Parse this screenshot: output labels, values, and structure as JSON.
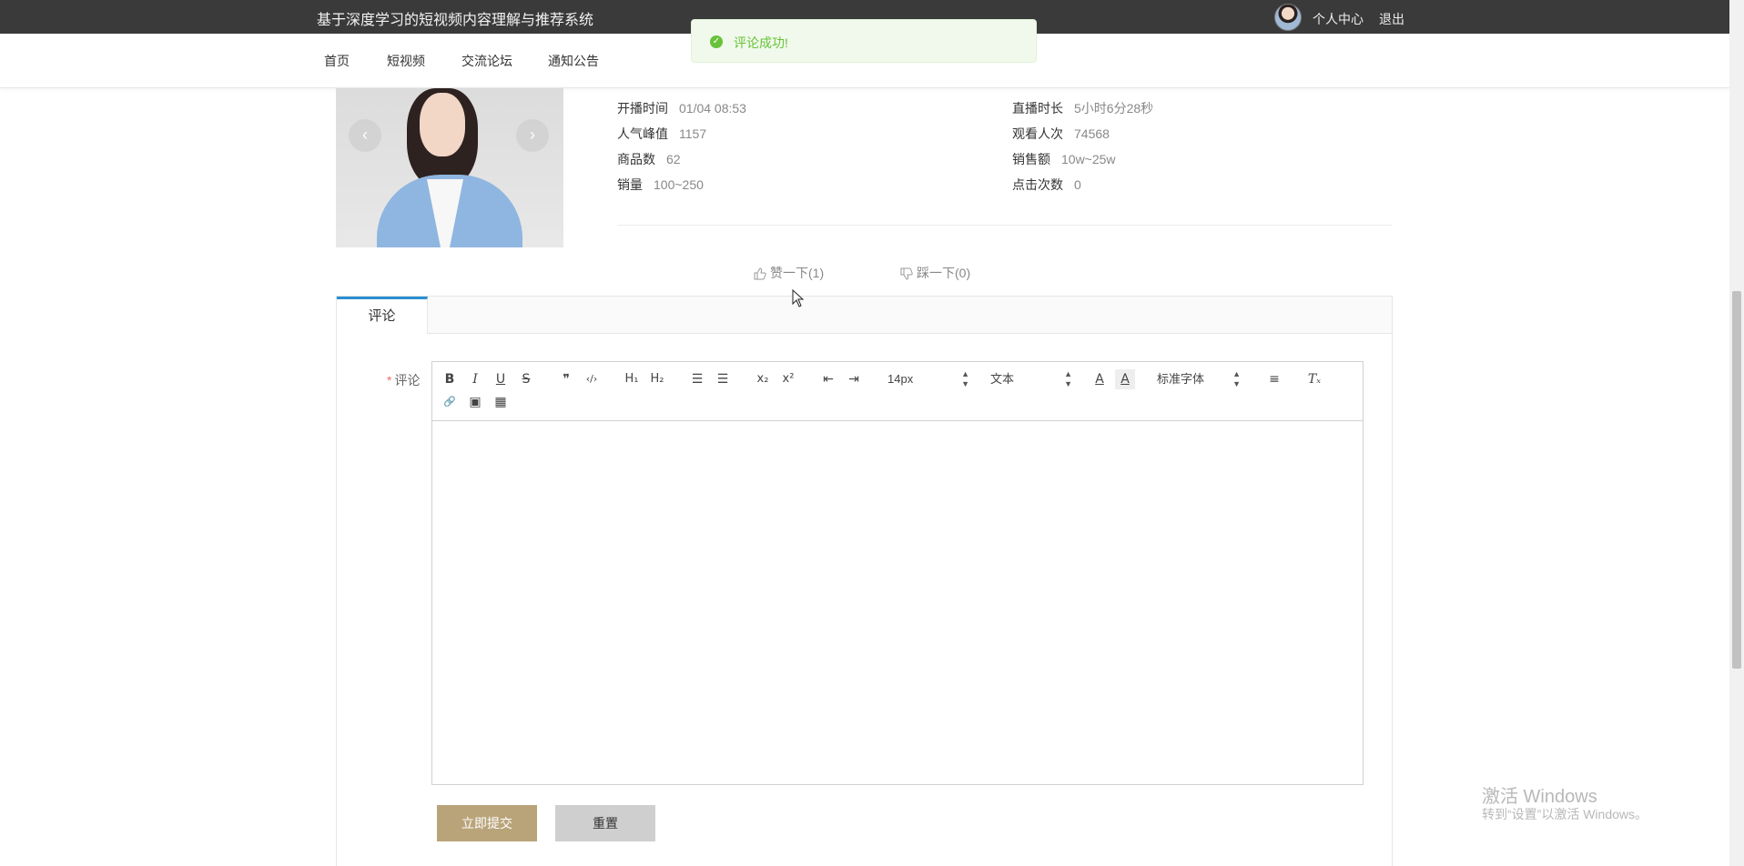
{
  "header": {
    "site_title": "基于深度学习的短视频内容理解与推荐系统",
    "user_center": "个人中心",
    "logout": "退出"
  },
  "nav": {
    "items": [
      "首页",
      "短视频",
      "交流论坛",
      "通知公告"
    ]
  },
  "toast": {
    "message": "评论成功!",
    "color": "#67c23a"
  },
  "hero": {
    "prev_arrow": "‹",
    "next_arrow": "›"
  },
  "info": {
    "left": [
      {
        "label": "开播时间",
        "value": "01/04 08:53"
      },
      {
        "label": "人气峰值",
        "value": "1157"
      },
      {
        "label": "商品数",
        "value": "62"
      },
      {
        "label": "销量",
        "value": "100~250"
      }
    ],
    "right": [
      {
        "label": "直播时长",
        "value": "5小时6分28秒"
      },
      {
        "label": "观看人次",
        "value": "74568"
      },
      {
        "label": "销售额",
        "value": "10w~25w"
      },
      {
        "label": "点击次数",
        "value": "0"
      }
    ]
  },
  "votes": {
    "like": "赞一下(1)",
    "dislike": "踩一下(0)"
  },
  "comment_panel": {
    "tab": "评论",
    "field_required_mark": "*",
    "field_label": "评论",
    "tab_accent": "#2a8fd0"
  },
  "editor": {
    "toolbar_row1": [
      {
        "name": "bold-button",
        "glyph": "B"
      },
      {
        "name": "italic-button",
        "glyph": "I"
      },
      {
        "name": "underline-button",
        "glyph": "U"
      },
      {
        "name": "strike-button",
        "glyph": "S"
      },
      {
        "name": "blockquote-button",
        "glyph": "❞"
      },
      {
        "name": "code-block-button",
        "glyph": "‹/›"
      },
      {
        "name": "header1-button",
        "glyph": "H₁"
      },
      {
        "name": "header2-button",
        "glyph": "H₂"
      },
      {
        "name": "ordered-list-button",
        "glyph": "☰"
      },
      {
        "name": "bullet-list-button",
        "glyph": "☰"
      },
      {
        "name": "subscript-button",
        "glyph": "x₂"
      },
      {
        "name": "superscript-button",
        "glyph": "x²"
      },
      {
        "name": "outdent-button",
        "glyph": "⇤"
      },
      {
        "name": "indent-button",
        "glyph": "⇥"
      }
    ],
    "size_picker": "14px",
    "header_picker": "文本",
    "font_picker": "标准字体",
    "toolbar_row1_after": [
      {
        "name": "text-color-button",
        "glyph": "A"
      },
      {
        "name": "background-color-button",
        "glyph": "A"
      },
      {
        "name": "align-button",
        "glyph": "≡"
      },
      {
        "name": "clear-format-button",
        "glyph": "Tₓ"
      }
    ],
    "toolbar_row2": [
      {
        "name": "link-button",
        "glyph": "🔗"
      },
      {
        "name": "image-button",
        "glyph": "▣"
      },
      {
        "name": "video-button",
        "glyph": "▦"
      }
    ],
    "content": ""
  },
  "buttons": {
    "submit": "立即提交",
    "reset": "重置",
    "submit_color": "#b9a47a",
    "reset_color": "#cfcfcf"
  },
  "watermark": {
    "line1": "激活 Windows",
    "line2": "转到“设置”以激活 Windows。"
  }
}
